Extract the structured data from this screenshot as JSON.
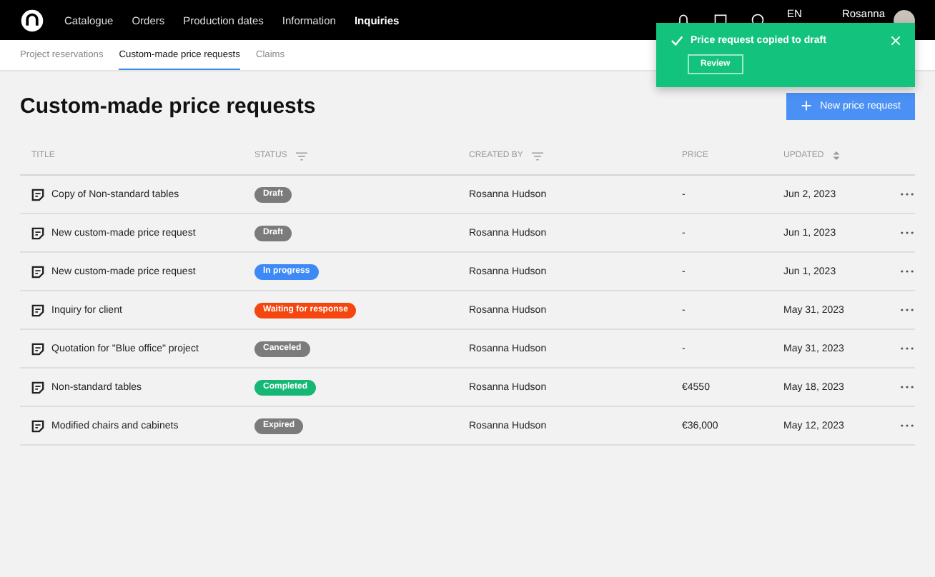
{
  "nav": {
    "items": [
      {
        "label": "Catalogue",
        "selected": false
      },
      {
        "label": "Orders",
        "selected": false
      },
      {
        "label": "Production dates",
        "selected": false
      },
      {
        "label": "Information",
        "selected": false
      },
      {
        "label": "Inquiries",
        "selected": true
      }
    ],
    "language": "EN",
    "user": "Rosanna"
  },
  "subtabs": [
    {
      "label": "Project reservations",
      "selected": false
    },
    {
      "label": "Custom-made price requests",
      "selected": true
    },
    {
      "label": "Claims",
      "selected": false
    }
  ],
  "page": {
    "title": "Custom-made price requests",
    "new_button": "New price request"
  },
  "table": {
    "columns": [
      "TITLE",
      "STATUS",
      "CREATED BY",
      "PRICE",
      "UPDATED"
    ],
    "rows": [
      {
        "title": "Copy of Non-standard tables",
        "status": "Draft",
        "color": "#7b7b7b",
        "created_by": "Rosanna Hudson",
        "price": "-",
        "updated": "Jun 2, 2023"
      },
      {
        "title": "New custom-made price request",
        "status": "Draft",
        "color": "#7b7b7b",
        "created_by": "Rosanna Hudson",
        "price": "-",
        "updated": "Jun 1, 2023"
      },
      {
        "title": "New custom-made price request",
        "status": "In progress",
        "color": "#3d8af7",
        "created_by": "Rosanna Hudson",
        "price": "-",
        "updated": "Jun 1, 2023"
      },
      {
        "title": "Inquiry for client",
        "status": "Waiting for response",
        "color": "#f4470f",
        "created_by": "Rosanna Hudson",
        "price": "-",
        "updated": "May 31, 2023"
      },
      {
        "title": "Quotation for \"Blue office\" project",
        "status": "Canceled",
        "color": "#7b7b7b",
        "created_by": "Rosanna Hudson",
        "price": "-",
        "updated": "May 31, 2023"
      },
      {
        "title": "Non-standard tables",
        "status": "Completed",
        "color": "#14b874",
        "created_by": "Rosanna Hudson",
        "price": "€4550",
        "updated": "May 18, 2023"
      },
      {
        "title": "Modified chairs and cabinets",
        "status": "Expired",
        "color": "#7b7b7b",
        "created_by": "Rosanna Hudson",
        "price": "€36,000",
        "updated": "May 12, 2023"
      }
    ]
  },
  "toast": {
    "message": "Price request copied to draft",
    "action": "Review"
  }
}
